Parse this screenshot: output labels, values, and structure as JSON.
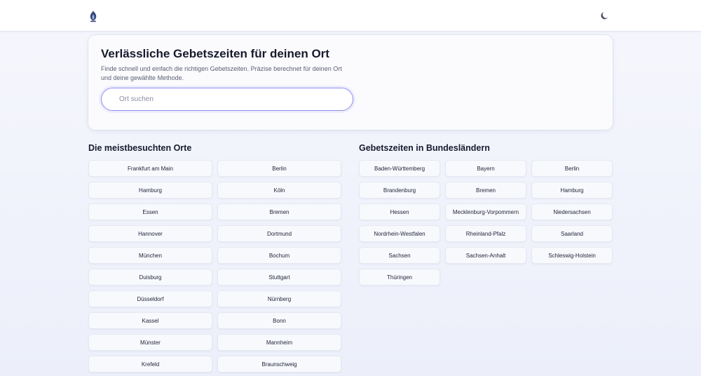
{
  "header": {
    "logo_icon": "mosque-dome-icon",
    "theme_toggle_icon": "moon-icon"
  },
  "hero": {
    "title": "Verlässliche Gebetszeiten für deinen Ort",
    "subtitle": "Finde schnell und einfach die richtigen Gebetszeiten. Präzise berechnet für deinen Ort und deine gewählte Methode.",
    "search": {
      "value": "",
      "placeholder": "Ort suchen"
    }
  },
  "popular": {
    "title": "Die meistbesuchten Orte",
    "items": [
      "Frankfurt am Main",
      "Berlin",
      "Hamburg",
      "Köln",
      "Essen",
      "Bremen",
      "Hannover",
      "Dortmund",
      "München",
      "Bochum",
      "Duisburg",
      "Stuttgart",
      "Düsseldorf",
      "Nürnberg",
      "Kassel",
      "Bonn",
      "Münster",
      "Mannheim",
      "Krefeld",
      "Braunschweig"
    ]
  },
  "states": {
    "title": "Gebetszeiten in Bundesländern",
    "items": [
      "Baden-Württemberg",
      "Bayern",
      "Berlin",
      "Brandenburg",
      "Bremen",
      "Hamburg",
      "Hessen",
      "Mecklenburg-Vorpommern",
      "Niedersachsen",
      "Nordrhein-Westfalen",
      "Rheinland-Pfalz",
      "Saarland",
      "Sachsen",
      "Sachsen-Anhalt",
      "Schleswig-Holstein",
      "Thüringen"
    ]
  },
  "colors": {
    "accent": "#8f8ef0",
    "logo": "#3a4a7a"
  }
}
